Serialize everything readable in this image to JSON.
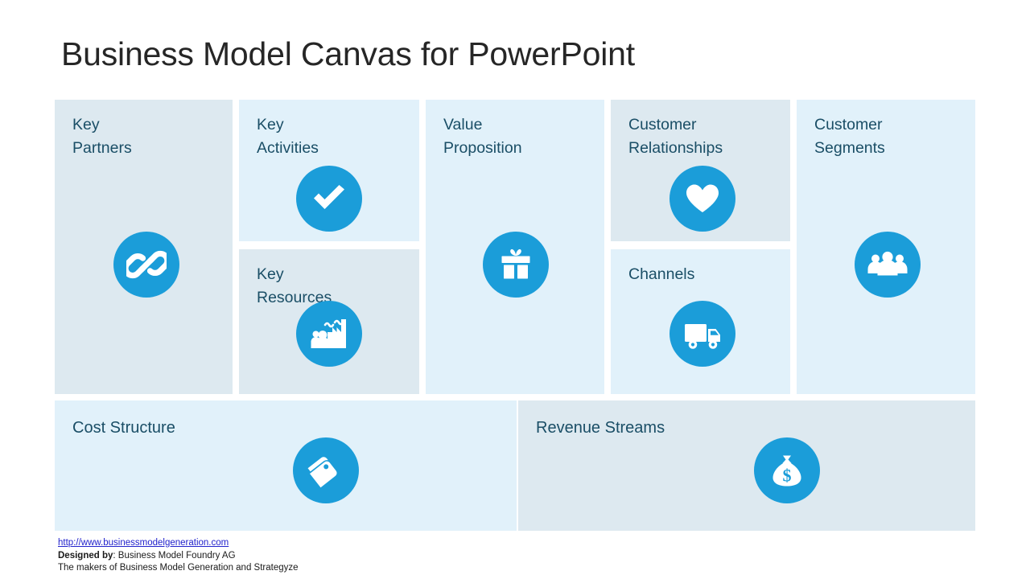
{
  "slide": {
    "title": "Business Model Canvas for PowerPoint"
  },
  "colors": {
    "icon_circle": "#1b9dd9",
    "panel_tint_muted": "#dde9f0",
    "panel_tint_light": "#e1f1fa",
    "heading_text": "#1a4e66",
    "title_text": "#262626",
    "link_text": "#2222cc"
  },
  "canvas": {
    "blocks": [
      {
        "id": "key-partners",
        "title": "Key\nPartners",
        "icon": "chain-link-icon",
        "tint": "muted"
      },
      {
        "id": "key-activities",
        "title": "Key\nActivities",
        "icon": "check-mark-icon",
        "tint": "light"
      },
      {
        "id": "key-resources",
        "title": "Key\nResources",
        "icon": "factory-people-icon",
        "tint": "muted"
      },
      {
        "id": "value-proposition",
        "title": "Value\nProposition",
        "icon": "gift-box-icon",
        "tint": "light"
      },
      {
        "id": "customer-relationships",
        "title": "Customer\nRelationships",
        "icon": "heart-icon",
        "tint": "muted"
      },
      {
        "id": "channels",
        "title": "Channels",
        "icon": "delivery-truck-icon",
        "tint": "light"
      },
      {
        "id": "customer-segments",
        "title": "Customer\nSegments",
        "icon": "people-group-icon",
        "tint": "light"
      },
      {
        "id": "cost-structure",
        "title": "Cost Structure",
        "icon": "price-tag-icon",
        "tint": "light"
      },
      {
        "id": "revenue-streams",
        "title": "Revenue Streams",
        "icon": "money-bag-icon",
        "tint": "muted"
      }
    ]
  },
  "footer": {
    "url": "http://www.businessmodelgeneration.com",
    "designed_by_label": "Designed by",
    "designed_by_value": ": Business Model Foundry AG",
    "makers_line": "The makers of Business Model Generation and Strategyze"
  }
}
